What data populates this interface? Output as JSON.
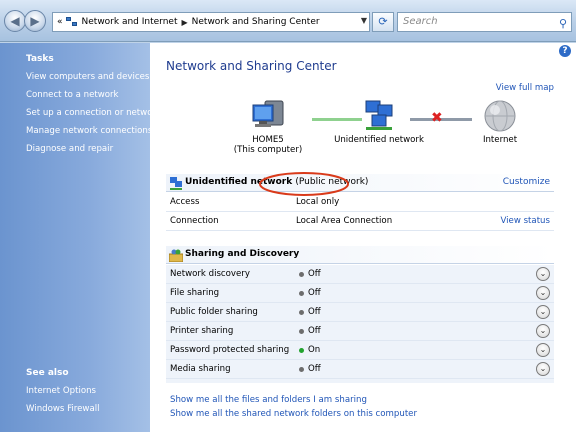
{
  "address_bar": {
    "breadcrumbs": [
      "Network and Internet",
      "Network and Sharing Center"
    ],
    "search_placeholder": "Search"
  },
  "tasks": {
    "header": "Tasks",
    "links": [
      "View computers and devices",
      "Connect to a network",
      "Set up a connection or network",
      "Manage network connections",
      "Diagnose and repair"
    ]
  },
  "see_also": {
    "header": "See also",
    "links": [
      "Internet Options",
      "Windows Firewall"
    ]
  },
  "main": {
    "title": "Network and Sharing Center",
    "view_full_map": "View full map",
    "map": {
      "computer_name": "HOME5",
      "computer_sub": "(This computer)",
      "network_name": "Unidentified network",
      "internet_name": "Internet"
    },
    "network": {
      "name": "Unidentified network",
      "type": "(Public network)",
      "customize": "Customize",
      "rows": [
        {
          "label": "Access",
          "value": "Local only",
          "action": ""
        },
        {
          "label": "Connection",
          "value": "Local Area Connection",
          "action": "View status"
        }
      ]
    },
    "sharing": {
      "header": "Sharing and Discovery",
      "items": [
        {
          "label": "Network discovery",
          "status": "Off",
          "on": false
        },
        {
          "label": "File sharing",
          "status": "Off",
          "on": false
        },
        {
          "label": "Public folder sharing",
          "status": "Off",
          "on": false
        },
        {
          "label": "Printer sharing",
          "status": "Off",
          "on": false
        },
        {
          "label": "Password protected sharing",
          "status": "On",
          "on": true
        },
        {
          "label": "Media sharing",
          "status": "Off",
          "on": false
        }
      ]
    },
    "bottom_links": [
      "Show me all the files and folders I am sharing",
      "Show me all the shared network folders on this computer"
    ]
  },
  "colors": {
    "link": "#2055b7",
    "annotation_circle": "#d93a1a",
    "status_on": "#22a32e",
    "status_off": "#6d6d6d"
  }
}
